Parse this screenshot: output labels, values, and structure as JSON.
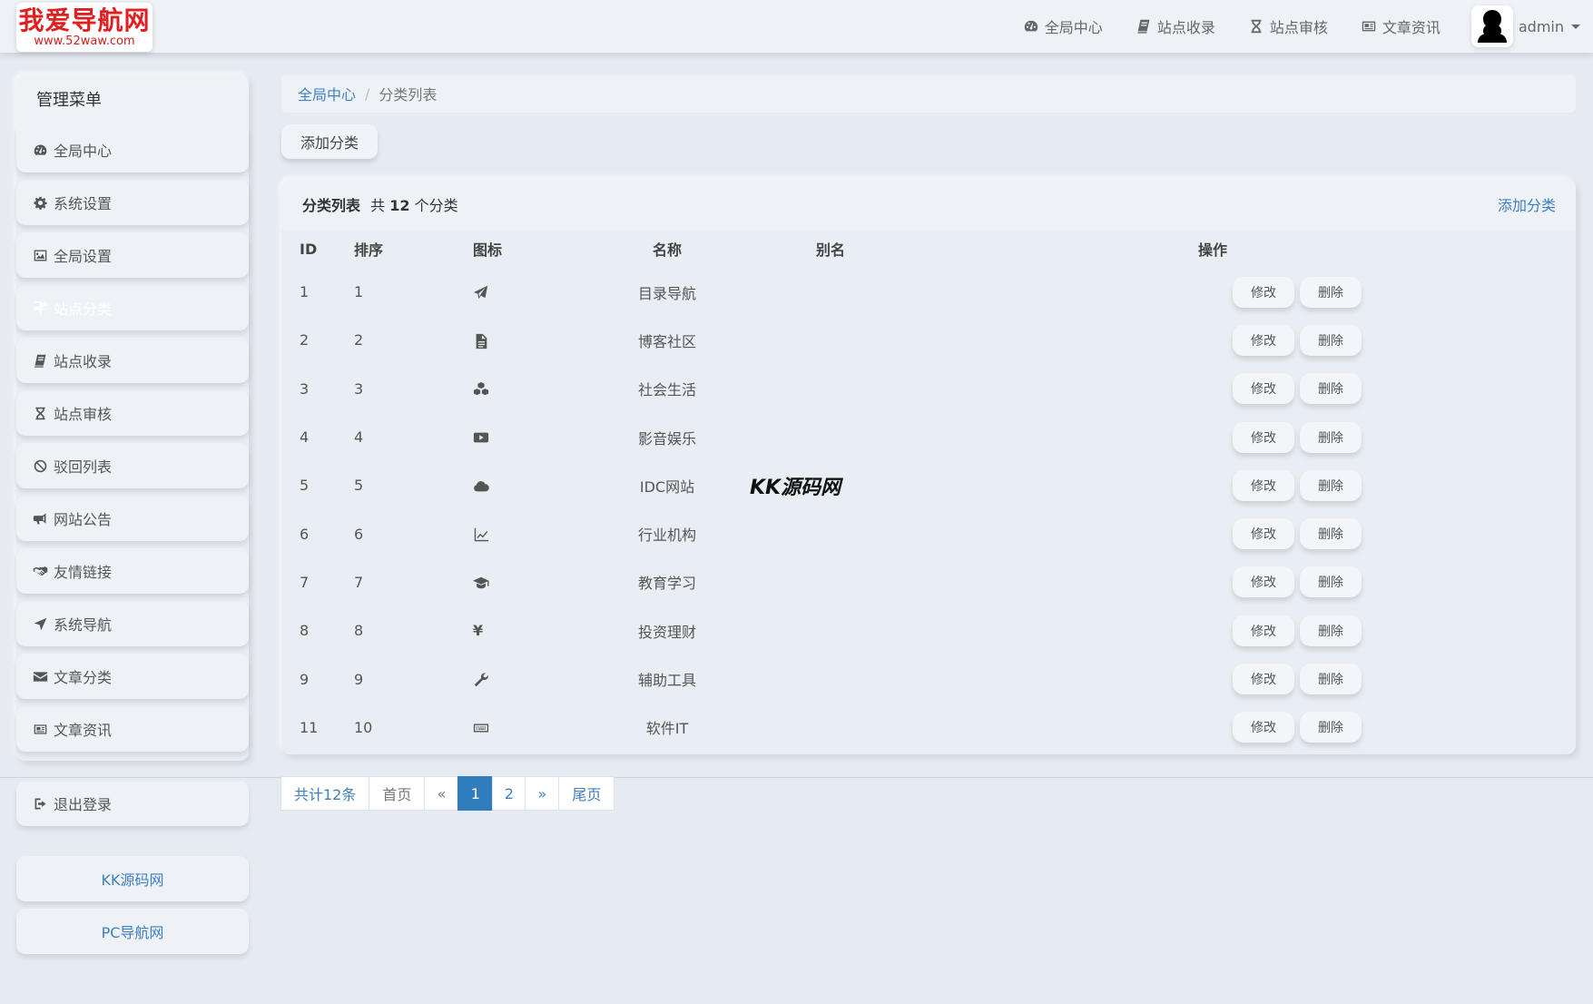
{
  "logo": {
    "title": "我爱导航网",
    "url": "www.52waw.com"
  },
  "topnav": {
    "items": [
      {
        "label": "全局中心",
        "icon": "dashboard-icon"
      },
      {
        "label": "站点收录",
        "icon": "book-icon"
      },
      {
        "label": "站点审核",
        "icon": "hourglass-icon"
      },
      {
        "label": "文章资讯",
        "icon": "newspaper-icon"
      }
    ],
    "user": "admin"
  },
  "sidebar": {
    "heading": "管理菜单",
    "items": [
      {
        "label": "全局中心",
        "icon": "dashboard-icon"
      },
      {
        "label": "系统设置",
        "icon": "gear-icon"
      },
      {
        "label": "全局设置",
        "icon": "image-icon"
      },
      {
        "label": "站点分类",
        "icon": "signpost-icon",
        "active": true
      },
      {
        "label": "站点收录",
        "icon": "book-icon"
      },
      {
        "label": "站点审核",
        "icon": "hourglass-icon"
      },
      {
        "label": "驳回列表",
        "icon": "ban-icon"
      },
      {
        "label": "网站公告",
        "icon": "bullhorn-icon"
      },
      {
        "label": "友情链接",
        "icon": "handshake-icon"
      },
      {
        "label": "系统导航",
        "icon": "location-arrow-icon"
      },
      {
        "label": "文章分类",
        "icon": "envelope-icon"
      },
      {
        "label": "文章资讯",
        "icon": "newspaper-icon"
      }
    ],
    "logout": {
      "label": "退出登录",
      "icon": "sign-out-icon"
    },
    "links": [
      "KK源码网",
      "PC导航网"
    ]
  },
  "breadcrumb": {
    "home": "全局中心",
    "current": "分类列表"
  },
  "add_button": "添加分类",
  "panel": {
    "title": "分类列表",
    "count_prefix": "共",
    "count": "12",
    "count_suffix": "个分类",
    "add_link": "添加分类",
    "columns": [
      "ID",
      "排序",
      "图标",
      "名称",
      "别名",
      "操作"
    ],
    "edit_label": "修改",
    "delete_label": "删除",
    "rows": [
      {
        "id": "1",
        "sort": "1",
        "icon": "paper-plane-icon",
        "name": "目录导航",
        "alias": ""
      },
      {
        "id": "2",
        "sort": "2",
        "icon": "file-text-icon",
        "name": "博客社区",
        "alias": ""
      },
      {
        "id": "3",
        "sort": "3",
        "icon": "cubes-icon",
        "name": "社会生活",
        "alias": ""
      },
      {
        "id": "4",
        "sort": "4",
        "icon": "youtube-play-icon",
        "name": "影音娱乐",
        "alias": ""
      },
      {
        "id": "5",
        "sort": "5",
        "icon": "cloud-icon",
        "name": "IDC网站",
        "alias": ""
      },
      {
        "id": "6",
        "sort": "6",
        "icon": "line-chart-icon",
        "name": "行业机构",
        "alias": ""
      },
      {
        "id": "7",
        "sort": "7",
        "icon": "graduation-cap-icon",
        "name": "教育学习",
        "alias": ""
      },
      {
        "id": "8",
        "sort": "8",
        "icon": "yen-icon",
        "name": "投资理财",
        "alias": ""
      },
      {
        "id": "9",
        "sort": "9",
        "icon": "wrench-icon",
        "name": "辅助工具",
        "alias": ""
      },
      {
        "id": "11",
        "sort": "10",
        "icon": "keyboard-icon",
        "name": "软件IT",
        "alias": ""
      }
    ]
  },
  "watermark": "KK源码网",
  "pagination": {
    "total": "共计12条",
    "first": "首页",
    "prev": "«",
    "pages": [
      "1",
      "2"
    ],
    "current": "1",
    "next": "»",
    "last": "尾页"
  },
  "colors": {
    "accent": "#2f7dbd",
    "link": "#3d7fbf",
    "background": "#e6ebf2",
    "logo_red": "#e02020"
  }
}
